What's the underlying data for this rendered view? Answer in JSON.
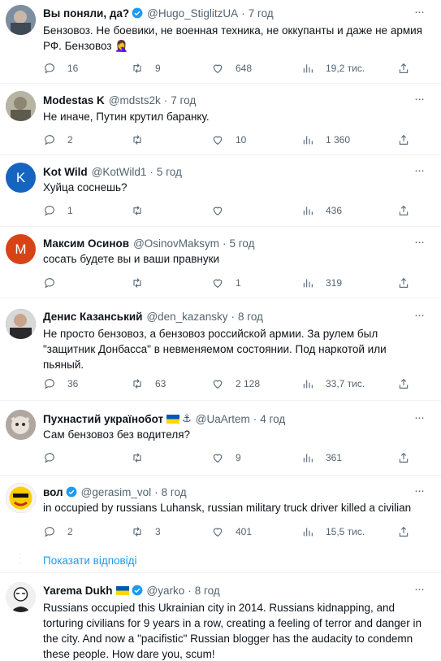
{
  "tweets": [
    {
      "name": "Вы поняли, да?",
      "handle": "@Hugo_StiglitzUA",
      "time": "7 год",
      "text": "Бензовоз. Не боевики, не военная техника, не оккупанты и даже не армия РФ. Бензовоз 🤦‍♀️",
      "replies": "16",
      "retweets": "9",
      "likes": "648",
      "views": "19,2 тис.",
      "avatar_color": "#6b7b8c"
    },
    {
      "name": "Modestas K",
      "handle": "@mdsts2k",
      "time": "7 год",
      "text": "Не иначе, Путин крутил баранку.",
      "replies": "2",
      "retweets": "",
      "likes": "10",
      "views": "1 360",
      "avatar_color": "#8a8a7a"
    },
    {
      "name": "Kot Wild",
      "handle": "@KotWild1",
      "time": "5 год",
      "text": "Хуйца соснешь?",
      "replies": "1",
      "retweets": "",
      "likes": "",
      "views": "436",
      "avatar_letter": "K",
      "avatar_color": "#1565c0"
    },
    {
      "name": "Максим Осинов",
      "handle": "@OsinovMaksym",
      "time": "5 год",
      "text": "сосать будете вы и ваши правнуки",
      "replies": "",
      "retweets": "",
      "likes": "1",
      "views": "319",
      "avatar_letter": "М",
      "avatar_color": "#d84315"
    },
    {
      "name": "Денис Казанський",
      "handle": "@den_kazansky",
      "time": "8 год",
      "text": "Не просто бензовоз, а бензовоз российской армии. За рулем был \"защитник Донбасса\" в невменяемом состоянии. Под наркотой или пьяный.",
      "replies": "36",
      "retweets": "63",
      "likes": "2 128",
      "views": "33,7 тис.",
      "avatar_color": "#4a4a4a"
    },
    {
      "name": "Пухнастий українобот",
      "handle": "@UaArtem",
      "time": "4 год",
      "text": "Сам бензовоз без водителя?",
      "replies": "",
      "retweets": "",
      "likes": "9",
      "views": "361",
      "avatar_color": "#9e9e9e"
    },
    {
      "name": "вол",
      "handle": "@gerasim_vol",
      "time": "8 год",
      "text": "in occupied by russians Luhansk, russian military truck driver killed a civilian",
      "replies": "2",
      "retweets": "3",
      "likes": "401",
      "views": "15,5 тис.",
      "avatar_color": "#e53935"
    },
    {
      "name": "Yarema Dukh",
      "handle": "@yarko",
      "time": "8 год",
      "text": "Russians occupied this Ukrainian city in 2014. Russians kidnapping, and torturing civilians for 9 years in a row, creating a feeling of terror and danger in the city. And now a \"pacifistic\" Russian blogger has the audacity to condemn these people. How dare you, scum!",
      "replies": "",
      "retweets": "",
      "likes": "",
      "views": "",
      "avatar_color": "#e0e0e0"
    }
  ],
  "show_replies_label": "Показати відповіді",
  "colors": {
    "accent": "#1d9bf0",
    "muted": "#536471",
    "text": "#0f1419",
    "divider": "#eff3f4"
  }
}
